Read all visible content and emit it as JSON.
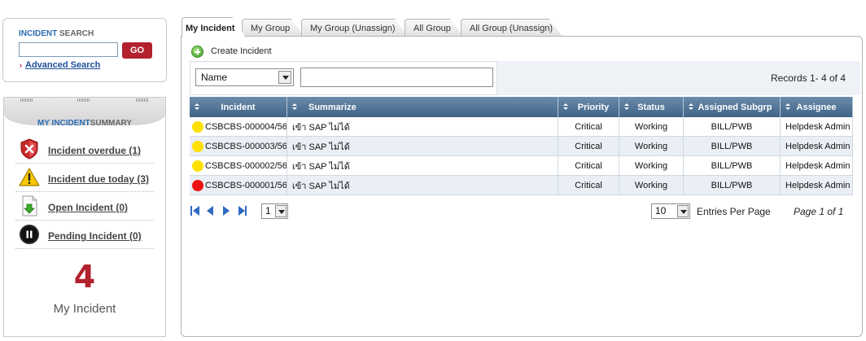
{
  "search": {
    "title_highlight": "INCIDENT",
    "title_rest": "SEARCH",
    "query": "",
    "go_label": "GO",
    "advanced_label": "Advanced Search"
  },
  "summary": {
    "title_highlight": "MY INCIDENT",
    "title_rest": "SUMMARY",
    "items": [
      {
        "label": "Incident overdue (1)",
        "icon": "shield-error-icon"
      },
      {
        "label": "Incident due today (3)",
        "icon": "warning-icon"
      },
      {
        "label": "Open Incident (0)",
        "icon": "download-document-icon"
      },
      {
        "label": "Pending Incident (0)",
        "icon": "pause-icon"
      }
    ],
    "count": "4",
    "count_label": "My Incident"
  },
  "tabs": [
    {
      "label": "My Incident",
      "active": true
    },
    {
      "label": "My Group",
      "active": false
    },
    {
      "label": "My Group (Unassign)",
      "active": false
    },
    {
      "label": "All Group",
      "active": false
    },
    {
      "label": "All Group (Unassign)",
      "active": false
    }
  ],
  "toolbar": {
    "create_label": "Create Incident"
  },
  "filter": {
    "field": "Name",
    "value": "",
    "records_text": "Records 1- 4  of 4"
  },
  "table": {
    "columns": [
      "Incident",
      "Summarize",
      "Priority",
      "Status",
      "Assigned Subgrp",
      "Assignee"
    ],
    "rows": [
      {
        "incident": "CSBCBS-000004/56",
        "status_color": "#ffe000",
        "summarize": "เข้า SAP ไม่ได้",
        "priority": "Critical",
        "status": "Working",
        "subgrp": "BILL/PWB",
        "assignee": "Helpdesk Admin"
      },
      {
        "incident": "CSBCBS-000003/56",
        "status_color": "#ffe000",
        "summarize": "เข้า SAP ไม่ได้",
        "priority": "Critical",
        "status": "Working",
        "subgrp": "BILL/PWB",
        "assignee": "Helpdesk Admin"
      },
      {
        "incident": "CSBCBS-000002/56",
        "status_color": "#ffe000",
        "summarize": "เข้า SAP ไม่ได้",
        "priority": "Critical",
        "status": "Working",
        "subgrp": "BILL/PWB",
        "assignee": "Helpdesk Admin"
      },
      {
        "incident": "CSBCBS-000001/56",
        "status_color": "#ee1111",
        "summarize": "เข้า SAP ไม่ได้",
        "priority": "Critical",
        "status": "Working",
        "subgrp": "BILL/PWB",
        "assignee": "Helpdesk Admin"
      }
    ]
  },
  "pager": {
    "page_select": "1",
    "per_page": "10",
    "entries_label": "Entries Per Page",
    "page_text": "Page 1 of  1"
  },
  "colors": {
    "brand_red": "#b3202e",
    "link_blue": "#1f4f9a",
    "header_blue": "#4e7295"
  }
}
